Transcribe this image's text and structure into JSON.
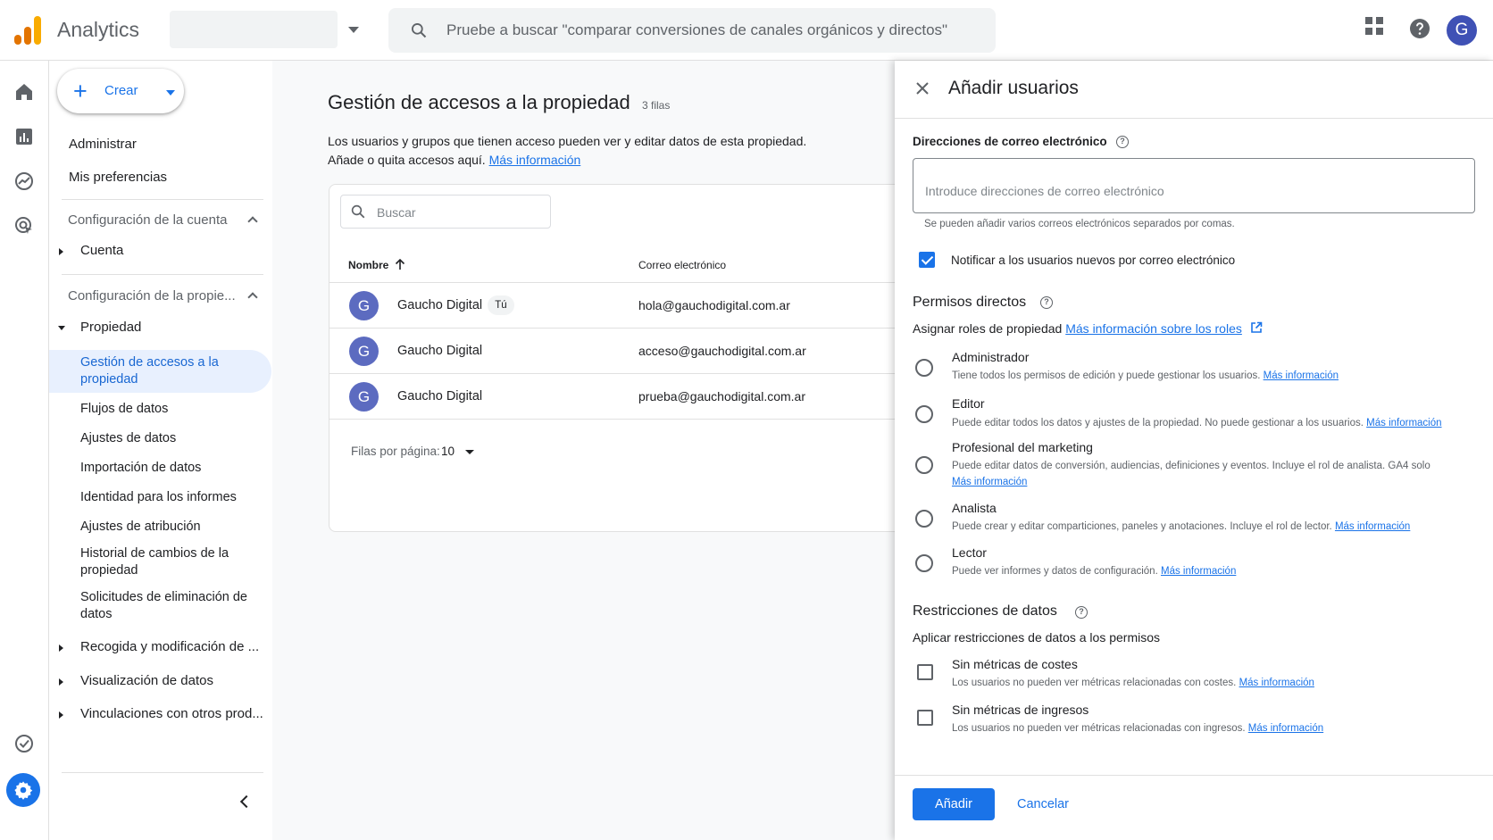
{
  "header": {
    "app_title": "Analytics",
    "search_placeholder": "Pruebe a buscar \"comparar conversiones de canales orgánicos y directos\"",
    "avatar_letter": "G",
    "logo_colors": [
      "#f9ab00",
      "#e37400",
      "#e37400"
    ]
  },
  "rail": {
    "icons": [
      "home-icon",
      "reports-icon",
      "explore-icon",
      "advertising-icon",
      "configure-icon",
      "admin-gear-icon"
    ]
  },
  "left_nav": {
    "create_label": "Crear",
    "admin": "Administrar",
    "preferences": "Mis preferencias",
    "account_config": "Configuración de la cuenta",
    "account": "Cuenta",
    "property_config": "Configuración de la propie...",
    "property": "Propiedad",
    "property_items": [
      "Gestión de accesos a la propiedad",
      "Flujos de datos",
      "Ajustes de datos",
      "Importación de datos",
      "Identidad para los informes",
      "Ajustes de atribución",
      "Historial de cambios de la propiedad",
      "Solicitudes de eliminación de datos"
    ],
    "groups": [
      "Recogida y modificación de ...",
      "Visualización de datos",
      "Vinculaciones con otros prod..."
    ]
  },
  "main": {
    "title": "Gestión de accesos a la propiedad",
    "row_count": "3 filas",
    "desc_line1": "Los usuarios y grupos que tienen acceso pueden ver y editar datos de esta propiedad.",
    "desc_line2": "Añade o quita accesos aquí.",
    "desc_link": "Más información",
    "search_placeholder": "Buscar",
    "col_name": "Nombre",
    "col_email": "Correo electrónico",
    "rows": [
      {
        "avatar": "G",
        "name": "Gaucho Digital",
        "badge": "Tú",
        "email": "hola@gauchodigital.com.ar"
      },
      {
        "avatar": "G",
        "name": "Gaucho Digital",
        "badge": "",
        "email": "acceso@gauchodigital.com.ar"
      },
      {
        "avatar": "G",
        "name": "Gaucho Digital",
        "badge": "",
        "email": "prueba@gauchodigital.com.ar"
      }
    ],
    "rows_per_page_label": "Filas por página:",
    "rows_per_page_value": "10"
  },
  "panel": {
    "title": "Añadir usuarios",
    "email_label": "Direcciones de correo electrónico",
    "email_placeholder": "Introduce direcciones de correo electrónico",
    "email_hint": "Se pueden añadir varios correos electrónicos separados por comas.",
    "notify_label": "Notificar a los usuarios nuevos por correo electrónico",
    "notify_checked": true,
    "perm_title": "Permisos directos",
    "perm_sub": "Asignar roles de propiedad",
    "perm_link": "Más información sobre los roles",
    "roles": [
      {
        "name": "Administrador",
        "desc": "Tiene todos los permisos de edición y puede gestionar los usuarios.",
        "link": "Más información"
      },
      {
        "name": "Editor",
        "desc": "Puede editar todos los datos y ajustes de la propiedad. No puede gestionar a los usuarios.",
        "link": "Más información"
      },
      {
        "name": "Profesional del marketing",
        "desc": "Puede editar datos de conversión, audiencias, definiciones y eventos. Incluye el rol de analista. GA4 solo",
        "link": "Más información"
      },
      {
        "name": "Analista",
        "desc": "Puede crear y editar comparticiones, paneles y anotaciones. Incluye el rol de lector.",
        "link": "Más información"
      },
      {
        "name": "Lector",
        "desc": "Puede ver informes y datos de configuración.",
        "link": "Más información"
      }
    ],
    "restr_title": "Restricciones de datos",
    "restr_sub": "Aplicar restricciones de datos a los permisos",
    "restrictions": [
      {
        "name": "Sin métricas de costes",
        "desc": "Los usuarios no pueden ver métricas relacionadas con costes.",
        "link": "Más información"
      },
      {
        "name": "Sin métricas de ingresos",
        "desc": "Los usuarios no pueden ver métricas relacionadas con ingresos.",
        "link": "Más información"
      }
    ],
    "add_label": "Añadir",
    "cancel_label": "Cancelar"
  }
}
